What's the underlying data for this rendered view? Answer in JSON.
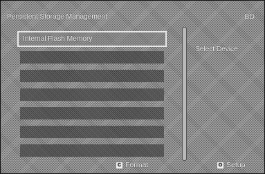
{
  "header": {
    "title": "Persistent Storage Management",
    "mode": "BD"
  },
  "list": {
    "items": [
      {
        "label": "Internal Flash Memory",
        "selected": true
      },
      {
        "label": ""
      },
      {
        "label": ""
      },
      {
        "label": ""
      },
      {
        "label": ""
      },
      {
        "label": ""
      },
      {
        "label": ""
      }
    ]
  },
  "side": {
    "label": "Select Device"
  },
  "footer": {
    "format": {
      "key": "C",
      "label": "Format"
    },
    "setup": {
      "key": "O",
      "label": "Setup"
    }
  }
}
